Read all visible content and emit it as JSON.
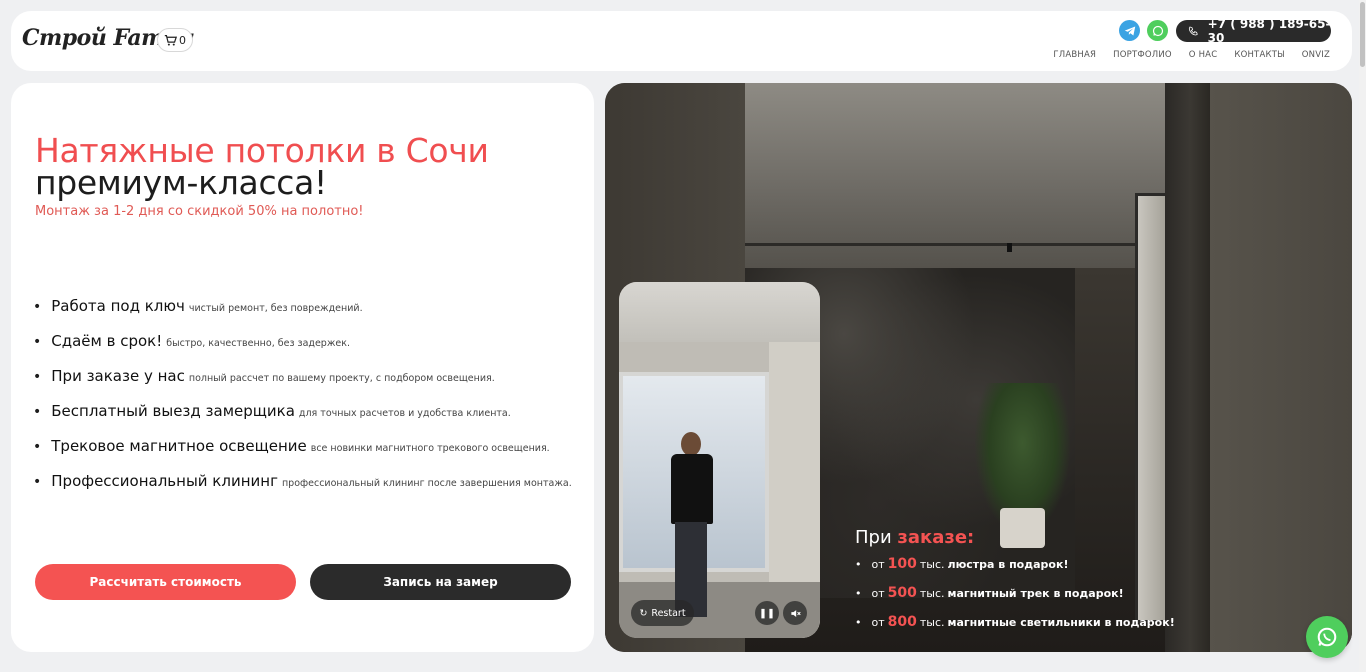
{
  "header": {
    "logo": "Строй Family",
    "cart_count": "0",
    "phone": "+7 ( 988 ) 189-65-30",
    "nav": [
      "ГЛАВНАЯ",
      "ПОРТФОЛИО",
      "О НАС",
      "КОНТАКТЫ",
      "ONVIZ"
    ]
  },
  "hero": {
    "title_accent": "Натяжные потолки в Сочи",
    "title_rest": "премиум-класса!",
    "subtitle": "Монтаж за 1-2 дня со скидкой 50% на полотно!",
    "features": [
      {
        "title": "Работа под ключ",
        "desc": "чистый ремонт, без повреждений."
      },
      {
        "title": "Сдаём в срок!",
        "desc": "быстро, качественно, без задержек."
      },
      {
        "title": "При заказе у нас",
        "desc": "полный рассчет по вашему проекту, с подбором освещения."
      },
      {
        "title": "Бесплатный выезд замерщика",
        "desc": "для точных расчетов и удобства клиента."
      },
      {
        "title": "Трековое магнитное освещение",
        "desc": "все новинки магнитного трекового освещения."
      },
      {
        "title": "Профессиональный клининг",
        "desc": "профессиональный клининг после завершения монтажа."
      }
    ],
    "btn_calculate": "Рассчитать стоимость",
    "btn_measure": "Запись на замер"
  },
  "promo": {
    "title_plain": "При",
    "title_accent": "заказе:",
    "items": [
      {
        "prefix": "от",
        "amount": "100",
        "unit": "тыс.",
        "text": "люстра в подарок!"
      },
      {
        "prefix": "от",
        "amount": "500",
        "unit": "тыс.",
        "text": "магнитный трек в подарок!"
      },
      {
        "prefix": "от",
        "amount": "800",
        "unit": "тыс.",
        "text": "магнитные светильники в подарок!"
      }
    ]
  },
  "video": {
    "restart_label": "Restart"
  },
  "colors": {
    "accent": "#f45352",
    "dark": "#2b2b2b",
    "telegram": "#3aa3e3",
    "whatsapp": "#4fce5d"
  },
  "icons": [
    "cart-icon",
    "telegram-icon",
    "whatsapp-icon",
    "phone-icon",
    "restart-icon",
    "pause-icon",
    "mute-icon"
  ]
}
